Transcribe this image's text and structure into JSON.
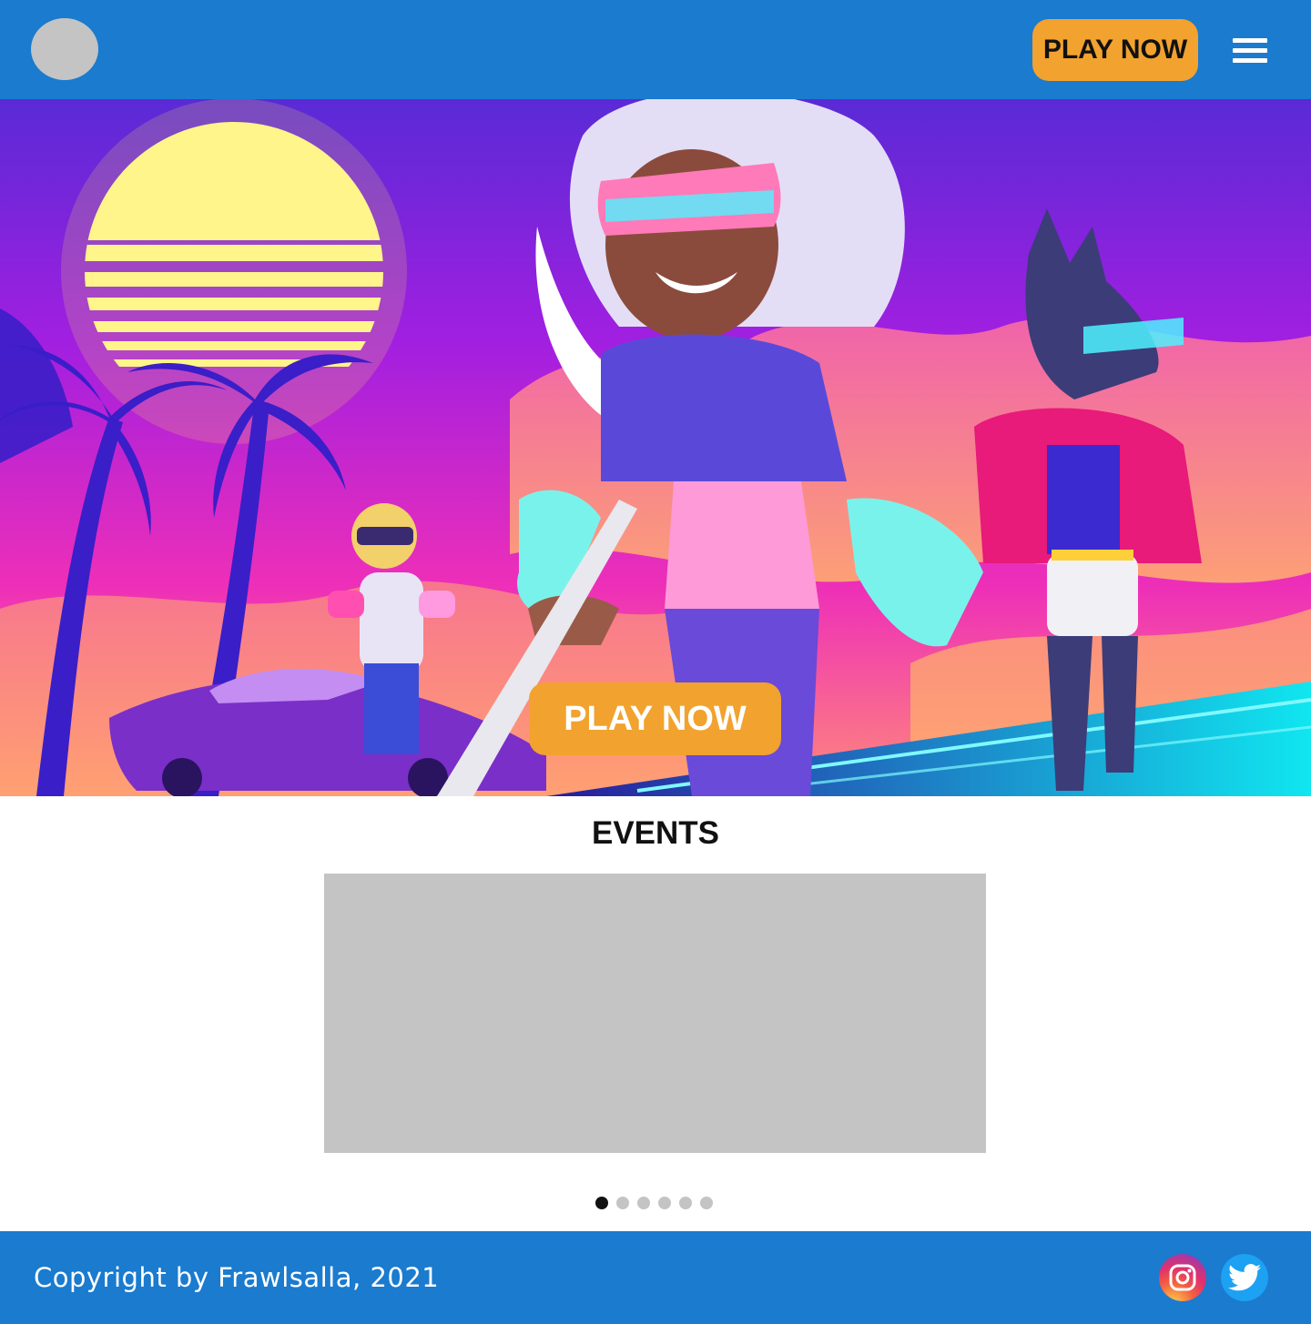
{
  "header": {
    "logo_icon": "logo-placeholder-icon",
    "play_label": "PLAY NOW",
    "menu_icon": "hamburger-menu-icon"
  },
  "hero": {
    "play_label": "PLAY NOW",
    "artwork": "synthwave-characters-illustration"
  },
  "events": {
    "title": "EVENTS",
    "slides_count": 6,
    "active_slide": 1
  },
  "footer": {
    "copyright": "Copyright by Frawlsalla, 2021",
    "social": [
      "instagram-icon",
      "twitter-icon"
    ]
  },
  "colors": {
    "primary": "#1a7bcf",
    "accent": "#f2a22e",
    "placeholder": "#c4c4c4",
    "dot_active": "#111111"
  }
}
